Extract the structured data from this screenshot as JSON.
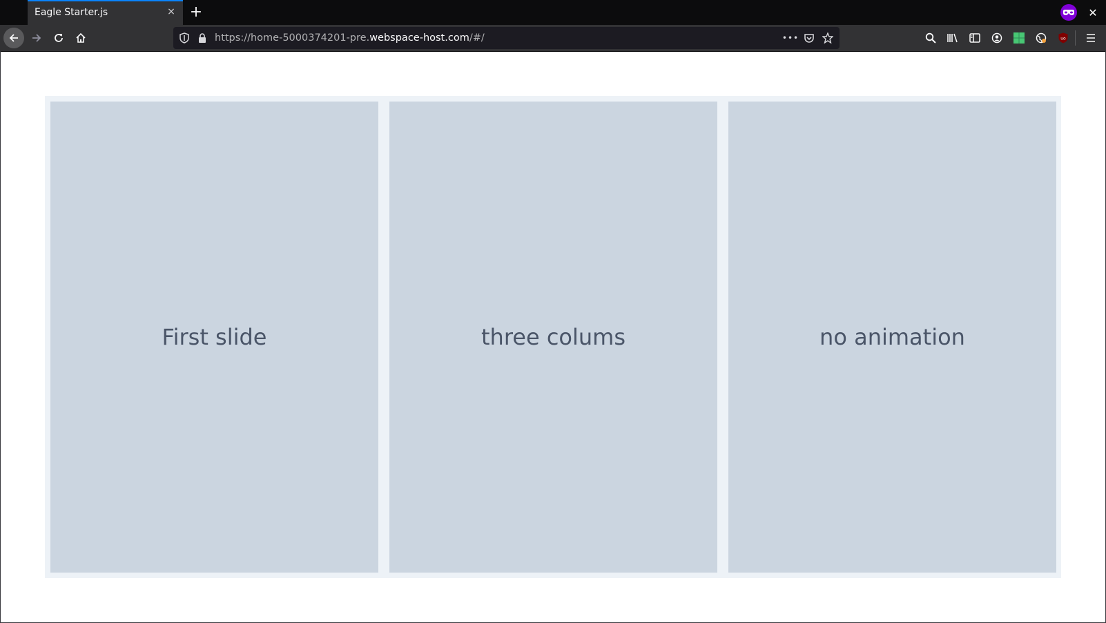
{
  "browser": {
    "tab_title": "Eagle Starter.js",
    "tab_close": "×",
    "new_tab": "+",
    "window_close": "✕",
    "url_prefix": "https://home-5000374201-pre.",
    "url_host": "webspace-host.com",
    "url_suffix": "/#/",
    "page_actions": "•••",
    "accent_color": "#0a84ff",
    "private_mask_color": "#8000d7"
  },
  "slides": [
    {
      "label": "First slide"
    },
    {
      "label": "three colums"
    },
    {
      "label": "no animation"
    }
  ],
  "colors": {
    "slider_background": "#edf2f7",
    "slide_background": "#cbd5e0",
    "slide_text": "#4a5568"
  }
}
